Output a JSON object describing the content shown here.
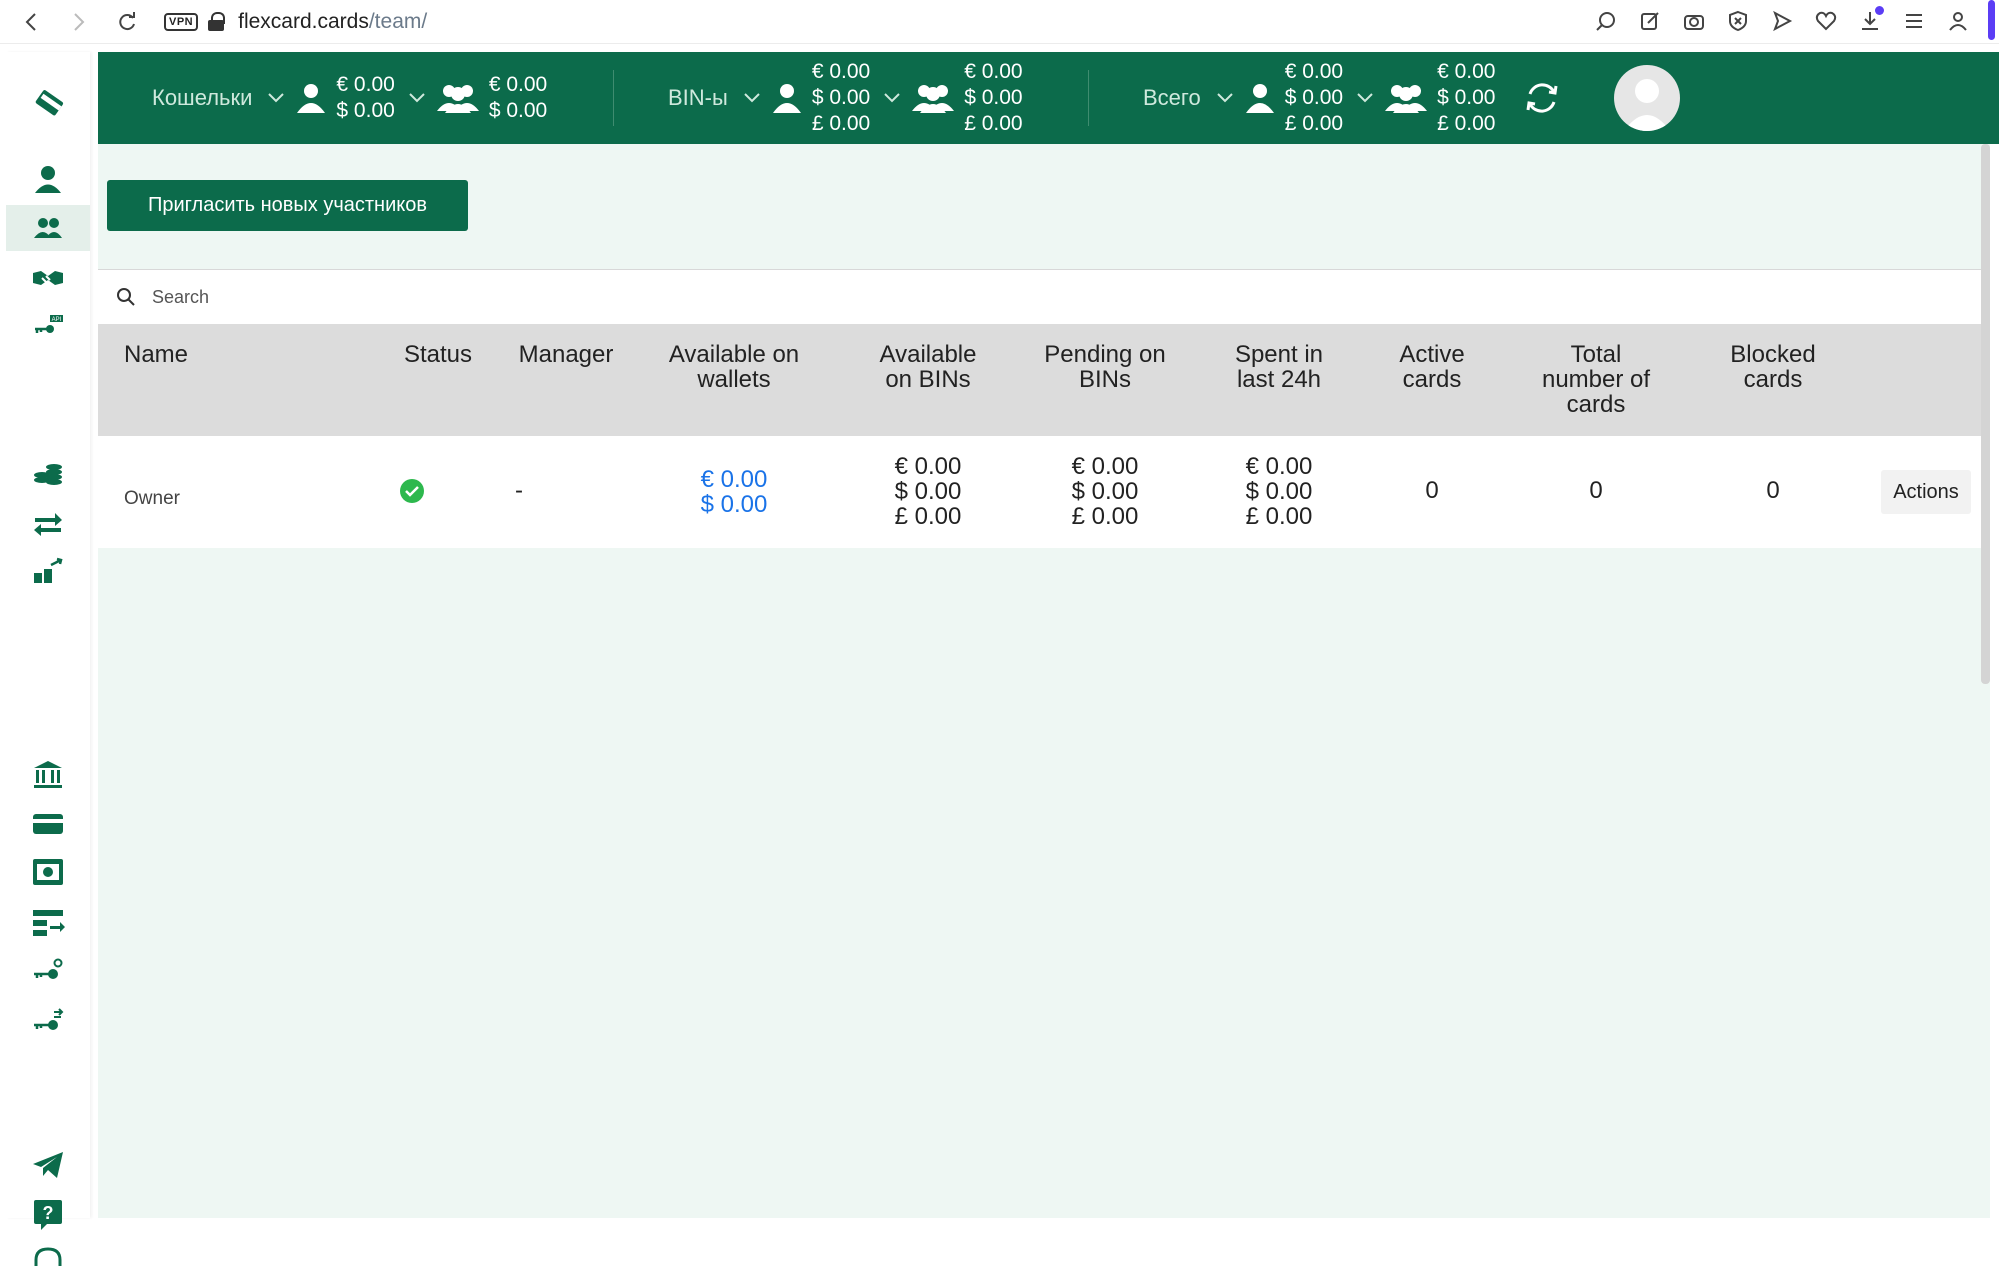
{
  "browser": {
    "url_host": "flexcard.cards",
    "url_path": "/team/",
    "vpn_label": "VPN"
  },
  "topbar": {
    "wallets": {
      "label": "Кошельки",
      "personal": [
        "€ 0.00",
        "$ 0.00"
      ],
      "team": [
        "€ 0.00",
        "$ 0.00"
      ]
    },
    "bins": {
      "label": "BIN-ы",
      "personal": [
        "€ 0.00",
        "$ 0.00",
        "£ 0.00"
      ],
      "team": [
        "€ 0.00",
        "$ 0.00",
        "£ 0.00"
      ]
    },
    "total": {
      "label": "Всего",
      "personal": [
        "€ 0.00",
        "$ 0.00",
        "£ 0.00"
      ],
      "team": [
        "€ 0.00",
        "$ 0.00",
        "£ 0.00"
      ]
    }
  },
  "main": {
    "invite_button": "Пригласить новых участников",
    "search_placeholder": "Search",
    "columns": [
      "Name",
      "Status",
      "Manager",
      "Available on wallets",
      "Available on BINs",
      "Pending on BINs",
      "Spent in last 24h",
      "Active cards",
      "Total number of cards",
      "Blocked cards"
    ],
    "rows": [
      {
        "name": "Owner",
        "status": "active",
        "manager": "-",
        "available_wallets": [
          "€ 0.00",
          "$ 0.00"
        ],
        "available_bins": [
          "€ 0.00",
          "$ 0.00",
          "£ 0.00"
        ],
        "pending_bins": [
          "€ 0.00",
          "$ 0.00",
          "£ 0.00"
        ],
        "spent_24h": [
          "€ 0.00",
          "$ 0.00",
          "£ 0.00"
        ],
        "active_cards": "0",
        "total_cards": "0",
        "blocked_cards": "0",
        "actions_label": "Actions"
      }
    ]
  },
  "colors": {
    "brand": "#0c6b4b",
    "status_ok": "#2db84d",
    "link": "#1a73e8"
  }
}
